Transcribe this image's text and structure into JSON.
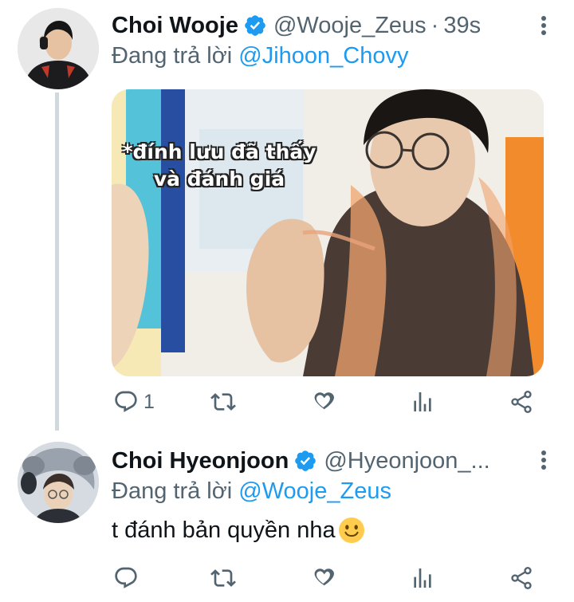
{
  "tweets": [
    {
      "author": "Choi Wooje",
      "handle": "@Wooje_Zeus",
      "separator": "·",
      "time": "39s",
      "reply_prefix": "Đang trả lời",
      "reply_to": "@Jihoon_Chovy",
      "media_caption_line1": "*đính lưu đã thấy",
      "media_caption_line2": "và đánh giá",
      "reply_count": "1"
    },
    {
      "author": "Choi Hyeonjoon",
      "handle": "@Hyeonjoon_...",
      "reply_prefix": "Đang trả lời",
      "reply_to": "@Wooje_Zeus",
      "text": "t đánh bản quyền nha"
    }
  ],
  "colors": {
    "verified": "#1d9bf0",
    "mention": "#1d9bf0",
    "secondary_text": "#536471",
    "thread_line": "#cfd9de"
  },
  "icons": {
    "reply": "reply-icon",
    "retweet": "retweet-icon",
    "like": "like-icon",
    "views": "views-icon",
    "share": "share-icon",
    "more": "more-options-icon",
    "verified": "verified-badge-icon",
    "emoji": "slightly-smiling-face-emoji"
  }
}
